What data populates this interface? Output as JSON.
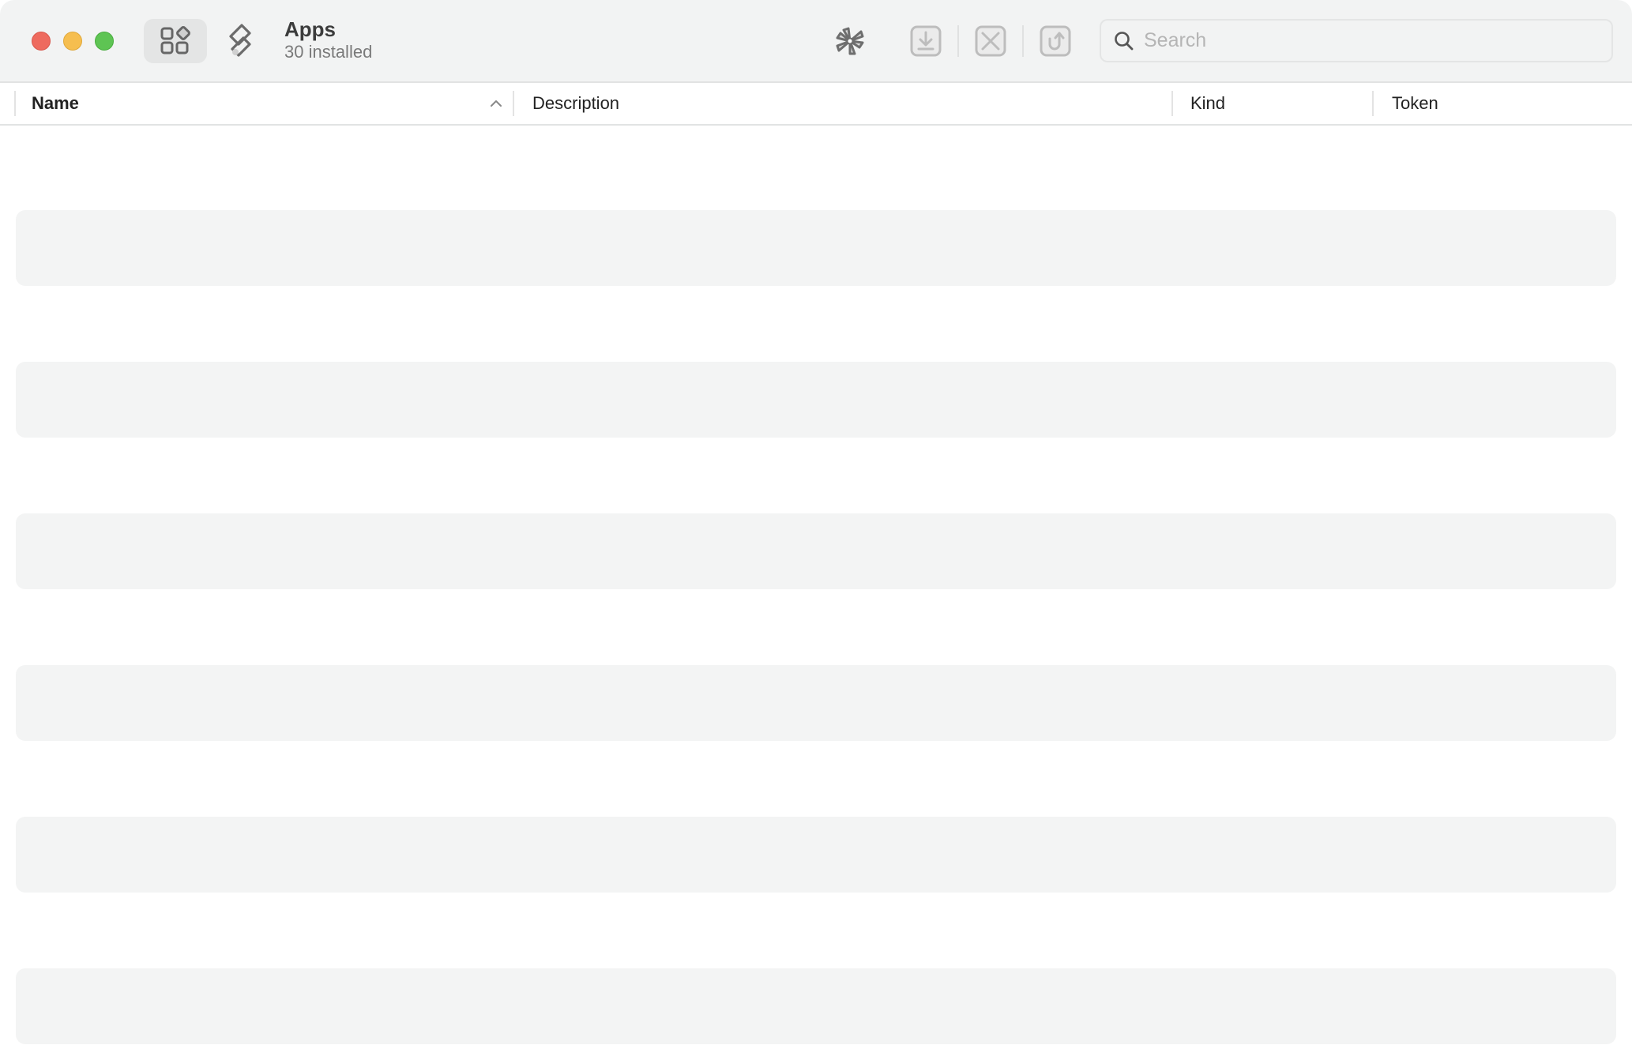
{
  "window": {
    "controls": [
      {
        "name": "close",
        "color": "#ee6a5e"
      },
      {
        "name": "minimize",
        "color": "#f6be4f"
      },
      {
        "name": "maximize",
        "color": "#5ec453"
      }
    ]
  },
  "toolbar": {
    "nav": [
      {
        "id": "apps",
        "icon": "apps-grid-icon",
        "selected": true
      },
      {
        "id": "shortcuts",
        "icon": "shortcuts-icon",
        "selected": false
      }
    ],
    "title": "Apps",
    "subtitle": "30 installed",
    "actions": [
      {
        "id": "pinwheel",
        "icon": "pinwheel-icon",
        "enabled": true
      },
      {
        "id": "download",
        "icon": "download-icon",
        "enabled": false
      },
      {
        "id": "remove",
        "icon": "remove-icon",
        "enabled": false
      },
      {
        "id": "share",
        "icon": "share-icon",
        "enabled": false
      }
    ],
    "search": {
      "placeholder": "Search",
      "value": ""
    }
  },
  "table": {
    "columns": [
      {
        "key": "name",
        "label": "Name",
        "sorted": "ascending"
      },
      {
        "key": "description",
        "label": "Description"
      },
      {
        "key": "kind",
        "label": "Kind"
      },
      {
        "key": "token",
        "label": "Token"
      }
    ],
    "loading": true,
    "skeleton_row_count": 6
  },
  "colors": {
    "toolbar_bg": "#f2f3f3",
    "skeleton": "#f3f4f4",
    "icon": "#6b6b6b",
    "icon_disabled": "#bdbdbd"
  }
}
